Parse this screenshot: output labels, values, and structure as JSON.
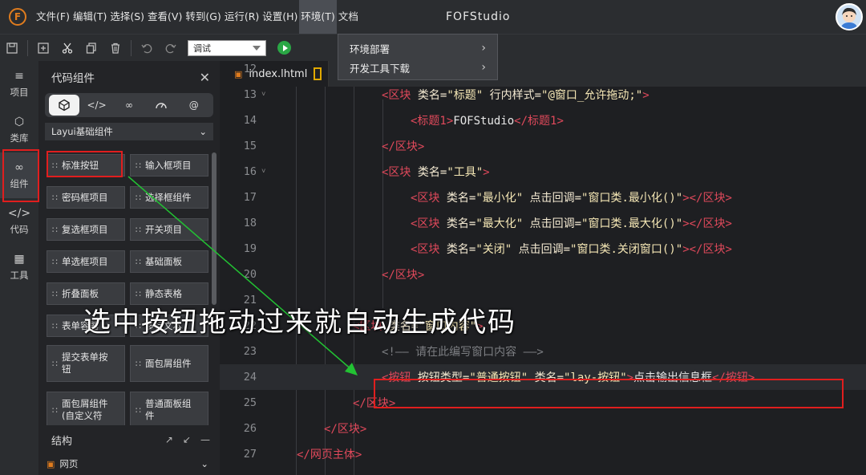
{
  "menubar": {
    "logo": "F",
    "items": [
      "文件(F)",
      "编辑(T)",
      "选择(S)",
      "查看(V)",
      "转到(G)",
      "运行(R)",
      "设置(H)",
      "环境(T)",
      "文档"
    ],
    "app_title": "FOFStudio"
  },
  "toolbar": {
    "mode_select": "调试"
  },
  "dropdown": {
    "items": [
      {
        "label": "环境部署"
      },
      {
        "label": "开发工具下载"
      }
    ]
  },
  "activity_bar": {
    "items": [
      "项目",
      "类库",
      "组件",
      "代码",
      "工具"
    ],
    "active": "组件"
  },
  "panel": {
    "title": "代码组件",
    "category_tabs": [
      "layers",
      "code",
      "link",
      "gauge",
      "at"
    ],
    "group": "Layui基础组件",
    "components": [
      "标准按钮",
      "输入框项目",
      "密码框项目",
      "选择框组件",
      "复选框项目",
      "开关项目",
      "单选框项目",
      "基础面板",
      "折叠面板",
      "静态表格",
      "表单容器",
      "多行文本",
      "提交表单按钮",
      "面包屑组件",
      "面包屑组件(自定义符",
      "普通面板组件"
    ],
    "structure_title": "结构",
    "structure_item": "网页"
  },
  "editor": {
    "tab": "index.lhtml",
    "lines": [
      {
        "no": "12",
        "html": ""
      },
      {
        "no": "13",
        "fold": true,
        "html": "<span class='tg'>&lt;区块</span> <span class='at'>类名=</span><span class='st'>\"标题\"</span> <span class='at'>行内样式=</span><span class='st'>\"@窗口_允许拖动;\"</span><span class='tg'>&gt;</span>"
      },
      {
        "no": "14",
        "html": "<span class='tg'>&lt;标题1&gt;</span>FOFStudio<span class='tg'>&lt;/标题1&gt;</span>"
      },
      {
        "no": "15",
        "html": "<span class='tg'>&lt;/区块&gt;</span>"
      },
      {
        "no": "16",
        "fold": true,
        "html": "<span class='tg'>&lt;区块</span> <span class='at'>类名=</span><span class='st'>\"工具\"</span><span class='tg'>&gt;</span>"
      },
      {
        "no": "17",
        "html": "<span class='tg'>&lt;区块</span> <span class='at'>类名=</span><span class='st'>\"最小化\"</span> <span class='at'>点击回调=</span><span class='st'>\"窗口类.最小化()\"</span><span class='tg'>&gt;&lt;/区块&gt;</span>"
      },
      {
        "no": "18",
        "html": "<span class='tg'>&lt;区块</span> <span class='at'>类名=</span><span class='st'>\"最大化\"</span> <span class='at'>点击回调=</span><span class='st'>\"窗口类.最大化()\"</span><span class='tg'>&gt;&lt;/区块&gt;</span>"
      },
      {
        "no": "19",
        "html": "<span class='tg'>&lt;区块</span> <span class='at'>类名=</span><span class='st'>\"关闭\"</span> <span class='at'>点击回调=</span><span class='st'>\"窗口类.关闭窗口()\"</span><span class='tg'>&gt;&lt;/区块&gt;</span>"
      },
      {
        "no": "20",
        "html": "<span class='tg'>&lt;/区块&gt;</span>"
      },
      {
        "no": "21",
        "html": ""
      },
      {
        "no": "22",
        "fold": true,
        "html": "<span class='tg'>&lt;区块</span> <span class='at'>类名=</span><span class='st'>\"窗口内容\"</span><span class='tg'>&gt;</span>"
      },
      {
        "no": "23",
        "html": "<span class='cm'>&lt;!—— 请在此编写窗口内容 ——&gt;</span>"
      },
      {
        "no": "24",
        "html": "<span class='tg'>&lt;按钮</span> <span class='at'>按钮类型=</span><span class='st'>\"普通按钮\"</span> <span class='at'>类名=</span><span class='st'>\"lay-按钮\"</span><span class='tg'>&gt;</span>点击输出信息框<span class='tg'>&lt;/按钮&gt;</span>"
      },
      {
        "no": "25",
        "html": "<span class='tg'>&lt;/区块&gt;</span>"
      },
      {
        "no": "26",
        "html": "<span class='tg'>&lt;/区块&gt;</span>"
      },
      {
        "no": "27",
        "html": "<span class='tg'>&lt;/网页主体&gt;</span>"
      }
    ]
  },
  "overlay_caption": "选中按钮拖动过来就自动生成代码",
  "colors": {
    "accent_red": "#e01e1e",
    "arrow_green": "#22c233",
    "tag": "#e0495b",
    "brand_orange": "#e07c1e"
  }
}
